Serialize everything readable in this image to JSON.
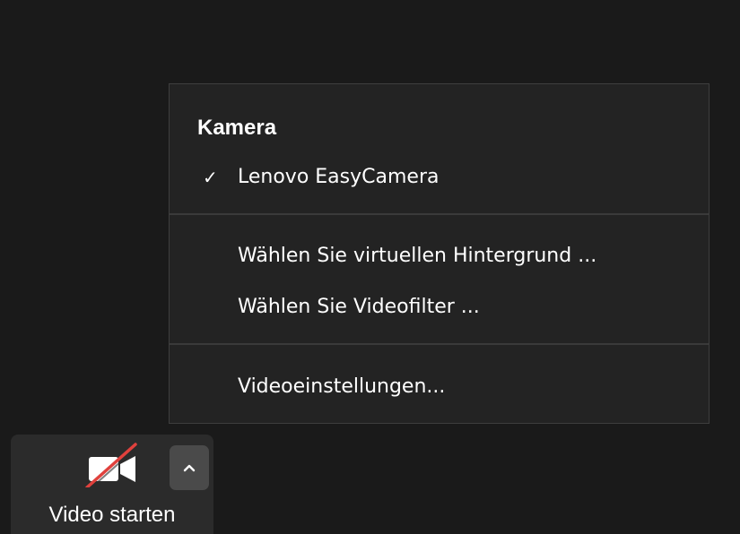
{
  "camera_menu": {
    "heading": "Kamera",
    "camera_device": {
      "label": "Lenovo EasyCamera",
      "selected": true,
      "check_glyph": "✓"
    },
    "background_item": "Wählen Sie virtuellen Hintergrund ...",
    "filter_item": "Wählen Sie Videofilter ...",
    "settings_item": "Videoeinstellungen..."
  },
  "toolbar": {
    "video_label": "Video starten",
    "video_icon": "camera-off-icon",
    "caret_icon": "chevron-up-icon"
  },
  "colors": {
    "background": "#1a1a1a",
    "menu_background": "#232323",
    "button_background": "#2b2b2b",
    "caret_background": "#4a4a4a",
    "slash_red": "#e0413d",
    "text": "#ffffff"
  }
}
